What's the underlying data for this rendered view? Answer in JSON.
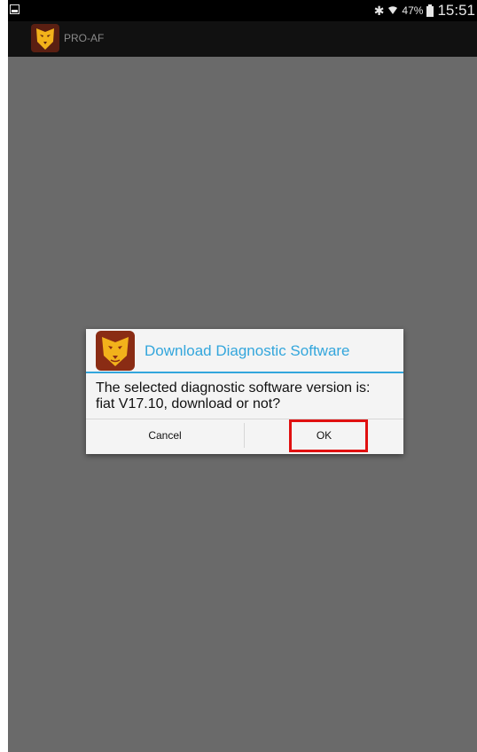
{
  "status_bar": {
    "battery_percent": "47%",
    "time": "15:51",
    "icons": [
      "screenshot-icon",
      "bluetooth-icon",
      "wifi-icon",
      "battery-icon"
    ]
  },
  "app_bar": {
    "title": "PRO-AF",
    "logo_icon": "lion-logo-icon"
  },
  "dialog": {
    "title": "Download Diagnostic Software",
    "message_line1": "The selected diagnostic software version is:",
    "message_line2": "fiat V17.10, download or not?",
    "cancel_label": "Cancel",
    "ok_label": "OK"
  },
  "colors": {
    "accent": "#33a6dc",
    "highlight": "#e01010",
    "background_dim": "#6a6a6a"
  }
}
